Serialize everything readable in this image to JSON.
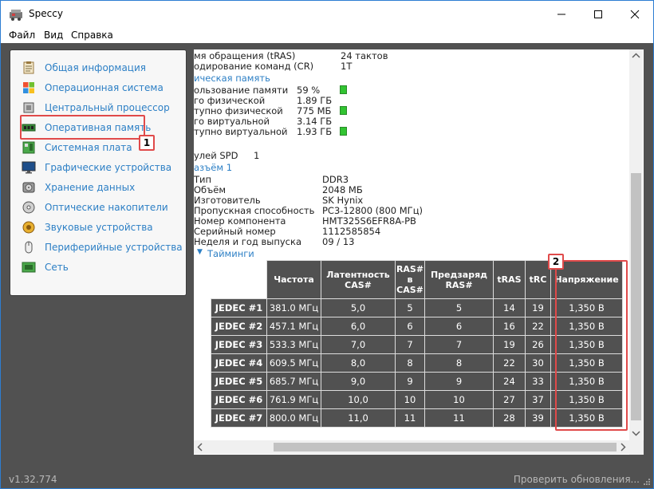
{
  "window": {
    "title": "Speccy",
    "minimize": "—",
    "maximize": "☐",
    "close": "✕"
  },
  "menu": {
    "file": "Файл",
    "view": "Вид",
    "help": "Справка"
  },
  "sidebar": {
    "items": [
      {
        "label": "Общая информация",
        "icon": "summary-icon"
      },
      {
        "label": "Операционная система",
        "icon": "windows-logo-icon"
      },
      {
        "label": "Центральный процессор",
        "icon": "cpu-chip-icon"
      },
      {
        "label": "Оперативная память",
        "icon": "ram-module-icon"
      },
      {
        "label": "Системная плата",
        "icon": "motherboard-icon"
      },
      {
        "label": "Графические устройства",
        "icon": "monitor-icon"
      },
      {
        "label": "Хранение данных",
        "icon": "hard-drive-icon"
      },
      {
        "label": "Оптические накопители",
        "icon": "optical-disc-icon"
      },
      {
        "label": "Звуковые устройства",
        "icon": "speaker-icon"
      },
      {
        "label": "Периферийные устройства",
        "icon": "mouse-icon"
      },
      {
        "label": "Сеть",
        "icon": "network-icon"
      }
    ],
    "selected": "Оперативная память"
  },
  "callouts": {
    "one": "1",
    "two": "2"
  },
  "details": {
    "tras_label": "мя обращения (tRAS)",
    "tras_value": "24 тактов",
    "cr_label": "одирование команд (CR)",
    "cr_value": "1T",
    "phys_section": "ическая память",
    "usage_label": "ользование памяти",
    "usage_value": "59 %",
    "phys_total_label": "го физической",
    "phys_total_value": "1.89 ГБ",
    "phys_avail_label": "тупно физической",
    "phys_avail_value": "775 МБ",
    "virt_total_label": "го виртуальной",
    "virt_total_value": "3.14 ГБ",
    "virt_avail_label": "тупно виртуальной",
    "virt_avail_value": "1.93 ГБ",
    "spd_label": "улей SPD",
    "spd_value": "1",
    "slot_section": "азъём 1",
    "type_label": "Тип",
    "type_value": "DDR3",
    "size_label": "Объём",
    "size_value": "2048 МБ",
    "mfr_label": "Изготовитель",
    "mfr_value": "SK Hynix",
    "bw_label": "Пропускная способность",
    "bw_value": "PC3-12800 (800 МГц)",
    "part_label": "Номер компонента",
    "part_value": "HMT325S6EFR8A-PB",
    "serial_label": "Серийный номер",
    "serial_value": "1112585854",
    "week_label": "Неделя и год выпуска",
    "week_value": "09 / 13",
    "timings_section": "Тайминги",
    "timings_arrow": "▼"
  },
  "timings": {
    "headers": {
      "freq": "Частота",
      "cas": "Латентность CAS#",
      "ras_cas_1": "RAS#",
      "ras_cas_2": "в",
      "ras_cas_3": "CAS#",
      "precharge": "Предзаряд RAS#",
      "tras": "tRAS",
      "trc": "tRC",
      "voltage": "Напряжение"
    },
    "rows": [
      {
        "name": "JEDEC #1",
        "freq": "381.0 МГц",
        "cas": "5,0",
        "rcd": "5",
        "rp": "5",
        "tras": "14",
        "trc": "19",
        "volt": "1,350 В"
      },
      {
        "name": "JEDEC #2",
        "freq": "457.1 МГц",
        "cas": "6,0",
        "rcd": "6",
        "rp": "6",
        "tras": "16",
        "trc": "22",
        "volt": "1,350 В"
      },
      {
        "name": "JEDEC #3",
        "freq": "533.3 МГц",
        "cas": "7,0",
        "rcd": "7",
        "rp": "7",
        "tras": "19",
        "trc": "26",
        "volt": "1,350 В"
      },
      {
        "name": "JEDEC #4",
        "freq": "609.5 МГц",
        "cas": "8,0",
        "rcd": "8",
        "rp": "8",
        "tras": "22",
        "trc": "30",
        "volt": "1,350 В"
      },
      {
        "name": "JEDEC #5",
        "freq": "685.7 МГц",
        "cas": "9,0",
        "rcd": "9",
        "rp": "9",
        "tras": "24",
        "trc": "33",
        "volt": "1,350 В"
      },
      {
        "name": "JEDEC #6",
        "freq": "761.9 МГц",
        "cas": "10,0",
        "rcd": "10",
        "rp": "10",
        "tras": "27",
        "trc": "37",
        "volt": "1,350 В"
      },
      {
        "name": "JEDEC #7",
        "freq": "800.0 МГц",
        "cas": "11,0",
        "rcd": "11",
        "rp": "11",
        "tras": "28",
        "trc": "39",
        "volt": "1,350 В"
      }
    ]
  },
  "status": {
    "version": "v1.32.774",
    "update": "Проверить обновления..."
  },
  "colors": {
    "accent": "#2c7fc5",
    "callout": "#e04a4a",
    "background": "#515151",
    "indicator": "#32c432"
  }
}
